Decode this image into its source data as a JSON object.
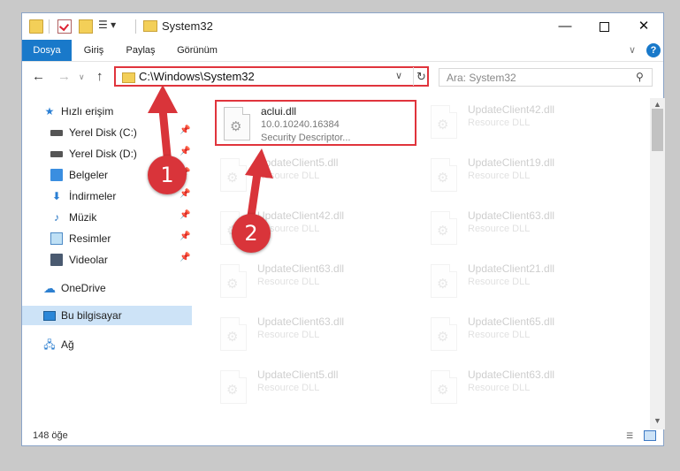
{
  "window": {
    "title": "System32"
  },
  "titlebar": {
    "customize_glyph": "▾"
  },
  "window_controls": {
    "minimize": "—",
    "close": "✕"
  },
  "ribbon": {
    "tabs": [
      "Dosya",
      "Giriş",
      "Paylaş",
      "Görünüm"
    ],
    "expand_glyph": "∨",
    "help_glyph": "?"
  },
  "navigation": {
    "back_glyph": "←",
    "forward_glyph": "→",
    "recent_glyph": "∨",
    "up_glyph": "↑"
  },
  "address_bar": {
    "path": "C:\\Windows\\System32",
    "dropdown_glyph": "∨",
    "refresh_glyph": "↻"
  },
  "search": {
    "placeholder": "Ara: System32",
    "icon_glyph": "⚲"
  },
  "sidebar": {
    "items": [
      {
        "label": "Hızlı erişim",
        "icon": "star-icon",
        "pinned": false
      },
      {
        "label": "Yerel Disk (C:)",
        "icon": "disk-icon",
        "pinned": true
      },
      {
        "label": "Yerel Disk (D:)",
        "icon": "disk-icon",
        "pinned": true
      },
      {
        "label": "Belgeler",
        "icon": "documents-folder-icon",
        "pinned": true
      },
      {
        "label": "İndirmeler",
        "icon": "download-icon",
        "pinned": true
      },
      {
        "label": "Müzik",
        "icon": "music-icon",
        "pinned": true
      },
      {
        "label": "Resimler",
        "icon": "pictures-icon",
        "pinned": true
      },
      {
        "label": "Videolar",
        "icon": "videos-icon",
        "pinned": true
      },
      {
        "label": "OneDrive",
        "icon": "cloud-icon",
        "pinned": false
      },
      {
        "label": "Bu bilgisayar",
        "icon": "computer-icon",
        "pinned": false,
        "selected": true
      },
      {
        "label": "Ağ",
        "icon": "network-icon",
        "pinned": false
      }
    ],
    "pin_glyph": "📌"
  },
  "files": [
    {
      "name": "aclui.dll",
      "line1": "10.0.10240.16384",
      "line2": "Security Descriptor...",
      "highlighted": true
    },
    {
      "name": "UpdateClient42.dll",
      "line1": "Resource DLL"
    },
    {
      "name": "UpdateClient5.dll",
      "line1": "Resource DLL"
    },
    {
      "name": "UpdateClient19.dll",
      "line1": "Resource DLL"
    },
    {
      "name": "UpdateClient42.dll",
      "line1": "Resource DLL"
    },
    {
      "name": "UpdateClient63.dll",
      "line1": "Resource DLL"
    },
    {
      "name": "UpdateClient63.dll",
      "line1": "Resource DLL"
    },
    {
      "name": "UpdateClient21.dll",
      "line1": "Resource DLL"
    },
    {
      "name": "UpdateClient63.dll",
      "line1": "Resource DLL"
    },
    {
      "name": "UpdateClient65.dll",
      "line1": "Resource DLL"
    },
    {
      "name": "UpdateClient5.dll",
      "line1": "Resource DLL"
    },
    {
      "name": "UpdateClient63.dll",
      "line1": "Resource DLL"
    }
  ],
  "status": {
    "item_count": "148 öğe"
  },
  "annotations": {
    "marker1": "1",
    "marker2": "2",
    "color": "#d9343a"
  },
  "colors": {
    "accent": "#1979ca",
    "highlight_border": "#e0343c",
    "selection": "#cde3f7"
  }
}
